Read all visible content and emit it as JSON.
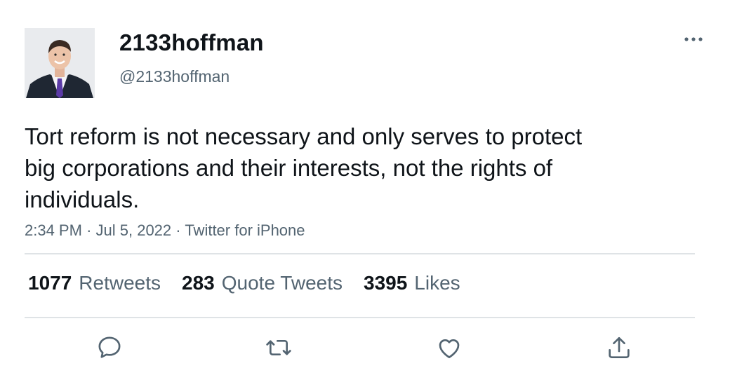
{
  "user": {
    "display_name": "2133hoffman",
    "handle": "@2133hoffman",
    "avatar_icon": "profile-photo"
  },
  "tweet": {
    "text": "Tort reform is not necessary and only serves to protect big corporations and their interests, not the rights of individuals.",
    "time": "2:34 PM",
    "separator": "·",
    "date": "Jul 5, 2022",
    "source": "Twitter for iPhone"
  },
  "stats": {
    "retweets": {
      "count": "1077",
      "label": "Retweets"
    },
    "quote_tweets": {
      "count": "283",
      "label": "Quote Tweets"
    },
    "likes": {
      "count": "3395",
      "label": "Likes"
    }
  },
  "actions": {
    "reply_icon": "comment-icon",
    "retweet_icon": "retweet-icon",
    "like_icon": "heart-icon",
    "share_icon": "share-icon",
    "more_icon": "more-horizontal-icon"
  },
  "colors": {
    "primary_text": "#0f1419",
    "secondary_text": "#536471",
    "divider": "#dfe3e6"
  }
}
